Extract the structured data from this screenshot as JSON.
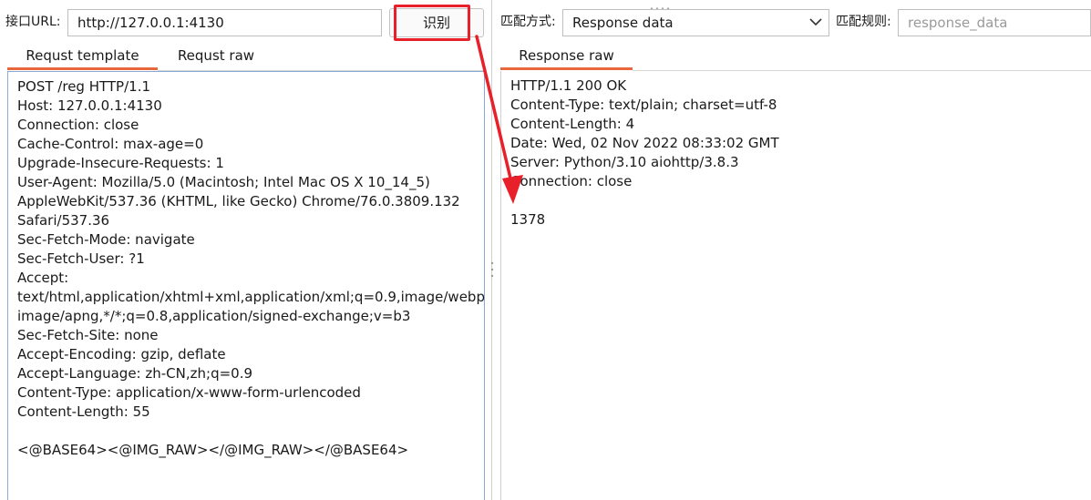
{
  "left": {
    "url_label": "接口URL:",
    "url_value": "http://127.0.0.1:4130",
    "identify_button": "识别",
    "tabs": [
      {
        "label": "Requst template",
        "active": true
      },
      {
        "label": "Requst raw",
        "active": false
      }
    ],
    "request_lines": [
      "POST /reg HTTP/1.1",
      "Host: 127.0.0.1:4130",
      "Connection: close",
      "Cache-Control: max-age=0",
      "Upgrade-Insecure-Requests: 1",
      "User-Agent: Mozilla/5.0 (Macintosh; Intel Mac OS X 10_14_5)",
      "AppleWebKit/537.36 (KHTML, like Gecko) Chrome/76.0.3809.132",
      "Safari/537.36",
      "Sec-Fetch-Mode: navigate",
      "Sec-Fetch-User: ?1",
      "Accept:",
      "text/html,application/xhtml+xml,application/xml;q=0.9,image/webp,",
      "image/apng,*/*;q=0.8,application/signed-exchange;v=b3",
      "Sec-Fetch-Site: none",
      "Accept-Encoding: gzip, deflate",
      "Accept-Language: zh-CN,zh;q=0.9",
      "Content-Type: application/x-www-form-urlencoded",
      "Content-Length: 55",
      "",
      "<@BASE64><@IMG_RAW></@IMG_RAW></@BASE64>"
    ]
  },
  "right": {
    "match_mode_label": "匹配方式:",
    "match_mode_value": "Response data",
    "match_rule_label": "匹配规则:",
    "match_rule_placeholder": "response_data",
    "tabs": [
      {
        "label": "Response raw",
        "active": true
      }
    ],
    "response_lines": [
      "HTTP/1.1 200 OK",
      "Content-Type: text/plain; charset=utf-8",
      "Content-Length: 4",
      "Date: Wed, 02 Nov 2022 08:33:02 GMT",
      "Server: Python/3.10 aiohttp/3.8.3",
      "Connection: close",
      "",
      "1378"
    ]
  },
  "colors": {
    "accent": "#e8673c",
    "annotation_red": "#e8202a",
    "focus_border": "#8aa9d6"
  }
}
